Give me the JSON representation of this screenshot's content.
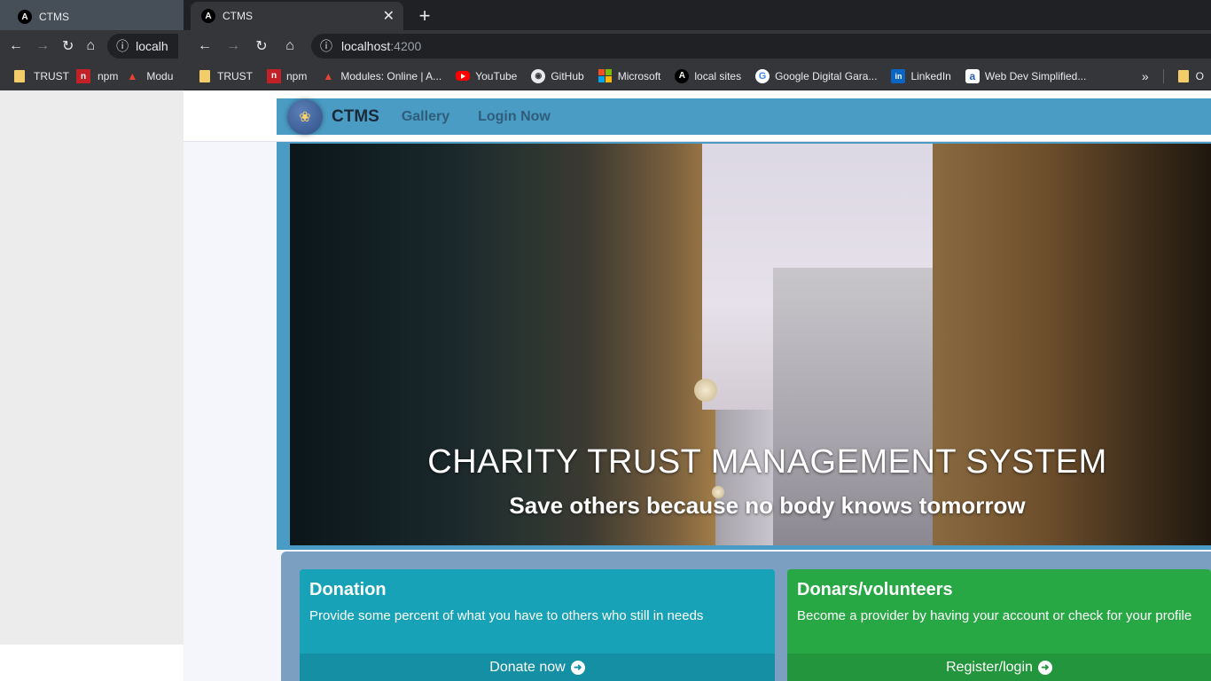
{
  "back_window": {
    "tab_title": "CTMS",
    "omnibox_text": "localh",
    "bookmarks": [
      "TRUST",
      "npm",
      "Modu"
    ]
  },
  "browser": {
    "tab_title": "CTMS",
    "url_host": "localhost",
    "url_port": ":4200",
    "bookmarks": [
      {
        "label": "TRUST",
        "icon": "folder-icon"
      },
      {
        "label": "npm",
        "icon": "npm-icon"
      },
      {
        "label": "Modules: Online | A...",
        "icon": "modules-icon"
      },
      {
        "label": "YouTube",
        "icon": "youtube-icon"
      },
      {
        "label": "GitHub",
        "icon": "github-icon"
      },
      {
        "label": "Microsoft",
        "icon": "microsoft-icon"
      },
      {
        "label": "local sites",
        "icon": "angular-icon"
      },
      {
        "label": "Google Digital Gara...",
        "icon": "google-icon"
      },
      {
        "label": "LinkedIn",
        "icon": "linkedin-icon"
      },
      {
        "label": "Web Dev Simplified...",
        "icon": "amazon-icon"
      }
    ],
    "overflow_label": "»",
    "trailing_bookmark": "O"
  },
  "app": {
    "brand": "CTMS",
    "nav": [
      "Gallery",
      "Login Now"
    ],
    "hero_title": "CHARITY TRUST MANAGEMENT SYSTEM",
    "hero_subtitle": "Save others because no body knows tomorrow",
    "cards": [
      {
        "title": "Donation",
        "text": "Provide some percent of what you have to others who still in needs",
        "action": "Donate now"
      },
      {
        "title": "Donars/volunteers",
        "text": "Become a provider by having your account or check for your profile",
        "action": "Register/login"
      }
    ]
  },
  "colors": {
    "navbar": "#4a9cc4",
    "donation_card": "#17a2b8",
    "donors_card": "#28a745",
    "cards_frame": "#7a9fc1"
  }
}
